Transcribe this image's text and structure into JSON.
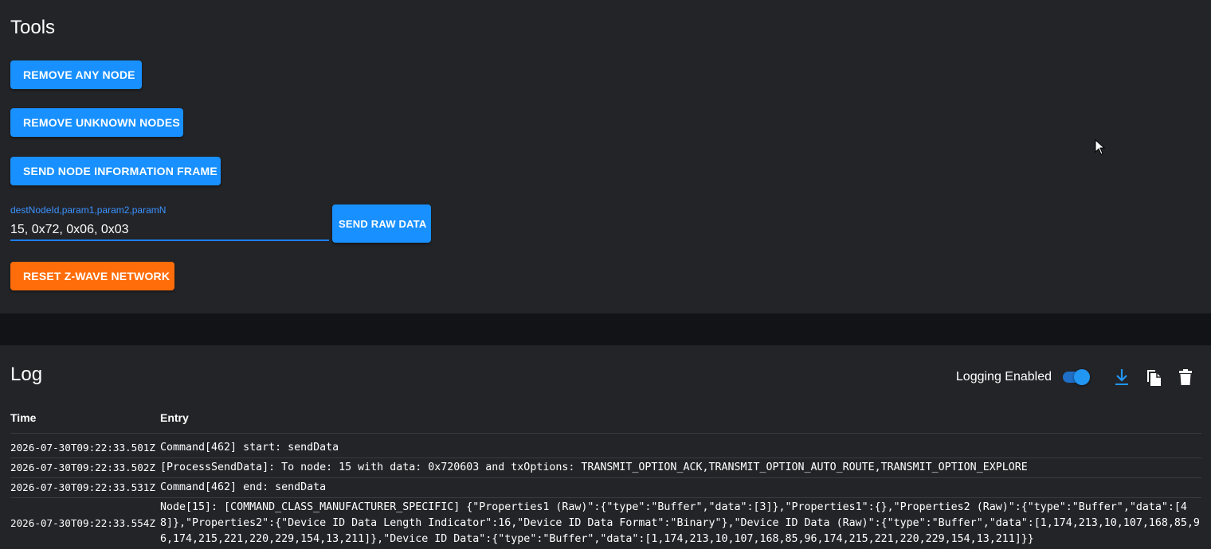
{
  "tools": {
    "title": "Tools",
    "remove_any_node": "REMOVE ANY NODE",
    "remove_unknown_nodes": "REMOVE UNKNOWN NODES",
    "send_node_information_frame": "SEND NODE INFORMATION FRAME",
    "raw_data": {
      "label": "destNodeId,param1,param2,paramN",
      "value": "15, 0x72, 0x06, 0x03",
      "button": "SEND RAW DATA"
    },
    "reset_network": "RESET Z-WAVE NETWORK"
  },
  "log": {
    "title": "Log",
    "logging_label": "Logging Enabled",
    "logging_enabled": true,
    "icons": [
      "download-icon",
      "copy-icon",
      "delete-icon"
    ],
    "columns": [
      "Time",
      "Entry"
    ],
    "rows": [
      {
        "time": "2026-07-30T09:22:33.501Z",
        "entry": "Command[462] start: sendData"
      },
      {
        "time": "2026-07-30T09:22:33.502Z",
        "entry": "[ProcessSendData]: To node: 15 with data: 0x720603 and txOptions: TRANSMIT_OPTION_ACK,TRANSMIT_OPTION_AUTO_ROUTE,TRANSMIT_OPTION_EXPLORE"
      },
      {
        "time": "2026-07-30T09:22:33.531Z",
        "entry": "Command[462] end: sendData"
      },
      {
        "time": "2026-07-30T09:22:33.554Z",
        "entry": "Node[15]: [COMMAND_CLASS_MANUFACTURER_SPECIFIC] {\"Properties1 (Raw)\":{\"type\":\"Buffer\",\"data\":[3]},\"Properties1\":{},\"Properties2 (Raw)\":{\"type\":\"Buffer\",\"data\":[48]},\"Properties2\":{\"Device ID Data Length Indicator\":16,\"Device ID Data Format\":\"Binary\"},\"Device ID Data (Raw)\":{\"type\":\"Buffer\",\"data\":[1,174,213,10,107,168,85,96,174,215,221,220,229,154,13,211]},\"Device ID Data\":{\"type\":\"Buffer\",\"data\":[1,174,213,10,107,168,85,96,174,215,221,220,229,154,13,211]}}"
      }
    ]
  },
  "colors": {
    "primary": "#1890ff",
    "warning": "#ff6d0a",
    "card_bg": "#232428",
    "page_bg": "#121316"
  }
}
